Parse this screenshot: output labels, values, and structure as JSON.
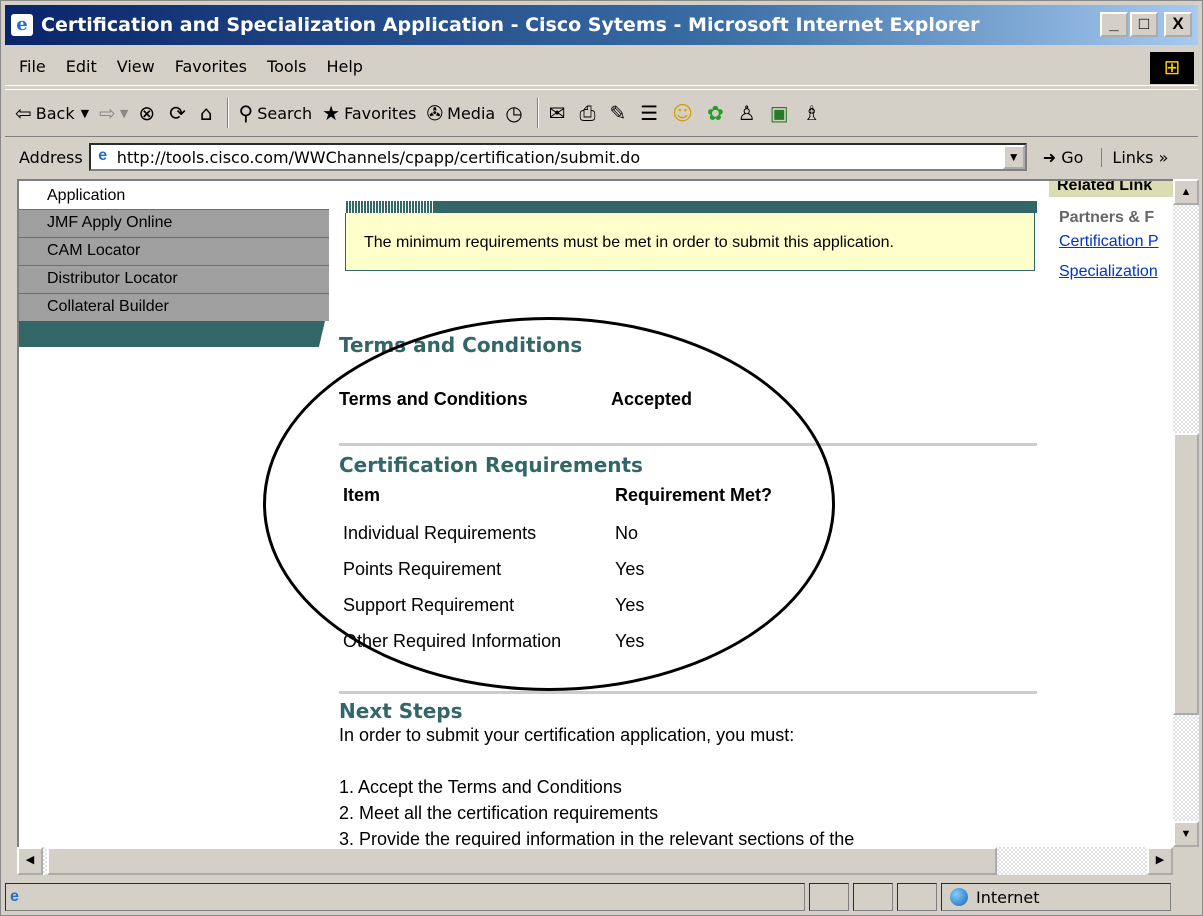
{
  "window": {
    "title": "Certification and Specialization Application - Cisco Sytems - Microsoft Internet Explorer",
    "controls": {
      "minimize": "_",
      "maximize": "□",
      "close": "X"
    }
  },
  "menu": [
    "File",
    "Edit",
    "View",
    "Favorites",
    "Tools",
    "Help"
  ],
  "toolbar": {
    "back": "Back",
    "search": "Search",
    "favorites": "Favorites",
    "media": "Media"
  },
  "address": {
    "label": "Address",
    "url": "http://tools.cisco.com/WWChannels/cpapp/certification/submit.do",
    "go": "Go",
    "links": "Links"
  },
  "leftnav": {
    "partial_item": "Application",
    "items": [
      "JMF Apply Online",
      "CAM Locator",
      "Distributor Locator",
      "Collateral Builder"
    ]
  },
  "main": {
    "message": "The minimum requirements must be met in order to submit this application.",
    "terms": {
      "heading": "Terms and Conditions",
      "label": "Terms and Conditions",
      "value": "Accepted"
    },
    "requirements": {
      "heading": "Certification Requirements",
      "col_item": "Item",
      "col_met": "Requirement Met?",
      "rows": [
        {
          "item": "Individual Requirements",
          "met": "No"
        },
        {
          "item": "Points Requirement",
          "met": "Yes"
        },
        {
          "item": "Support Requirement",
          "met": "Yes"
        },
        {
          "item": "Other Required Information",
          "met": "Yes"
        }
      ]
    },
    "next_steps": {
      "heading": "Next Steps",
      "intro": "In order to submit your certification application, you must:",
      "steps": [
        "1. Accept the Terms and Conditions",
        "2. Meet all the certification requirements",
        "3. Provide the required information in the relevant sections of the"
      ]
    }
  },
  "rightcol": {
    "tab": "Related Link",
    "heading": "Partners & F",
    "links": [
      "Certification P",
      "Specialization"
    ]
  },
  "status": {
    "zone": "Internet"
  },
  "colors": {
    "teal": "#336666",
    "nav_gray": "#a0a0a0",
    "msg_bg": "#ffffcc",
    "link": "#0033cc"
  }
}
